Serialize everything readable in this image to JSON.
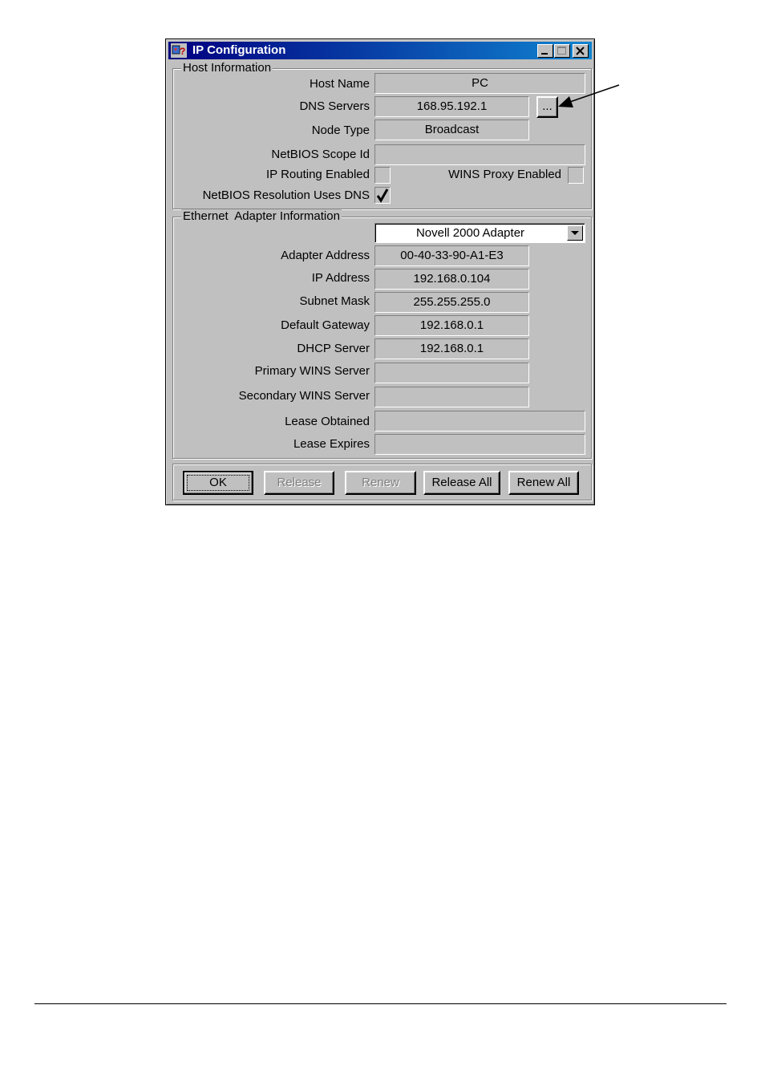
{
  "window": {
    "title": "IP Configuration"
  },
  "host_info": {
    "group_label": "Host Information",
    "host_name_label": "Host Name",
    "host_name": "PC",
    "dns_servers_label": "DNS Servers",
    "dns_servers": "168.95.192.1",
    "dns_more_button": "...",
    "node_type_label": "Node Type",
    "node_type": "Broadcast",
    "netbios_scope_label": "NetBIOS Scope Id",
    "netbios_scope": "",
    "ip_routing_label": "IP Routing Enabled",
    "ip_routing_checked": false,
    "wins_proxy_label": "WINS Proxy Enabled",
    "wins_proxy_checked": false,
    "netbios_dns_label": "NetBIOS Resolution Uses DNS",
    "netbios_dns_checked": true
  },
  "adapter_info": {
    "group_label": "Ethernet  Adapter Information",
    "adapter_selected": "Novell 2000 Adapter",
    "adapter_address_label": "Adapter Address",
    "adapter_address": "00-40-33-90-A1-E3",
    "ip_address_label": "IP Address",
    "ip_address": "192.168.0.104",
    "subnet_mask_label": "Subnet Mask",
    "subnet_mask": "255.255.255.0",
    "default_gateway_label": "Default Gateway",
    "default_gateway": "192.168.0.1",
    "dhcp_server_label": "DHCP Server",
    "dhcp_server": "192.168.0.1",
    "primary_wins_label": "Primary WINS Server",
    "primary_wins": "",
    "secondary_wins_label": "Secondary WINS Server",
    "secondary_wins": "",
    "lease_obtained_label": "Lease Obtained",
    "lease_obtained": "",
    "lease_expires_label": "Lease Expires",
    "lease_expires": ""
  },
  "buttons": {
    "ok": "OK",
    "release": "Release",
    "renew": "Renew",
    "release_all": "Release All",
    "renew_all": "Renew All"
  },
  "icons": {
    "app": "ip-config-icon",
    "minimize": "minimize-icon",
    "maximize": "maximize-icon",
    "close": "close-icon",
    "dropdown": "chevron-down-icon",
    "check": "checkmark-icon",
    "annotation": "arrow-pointer"
  }
}
